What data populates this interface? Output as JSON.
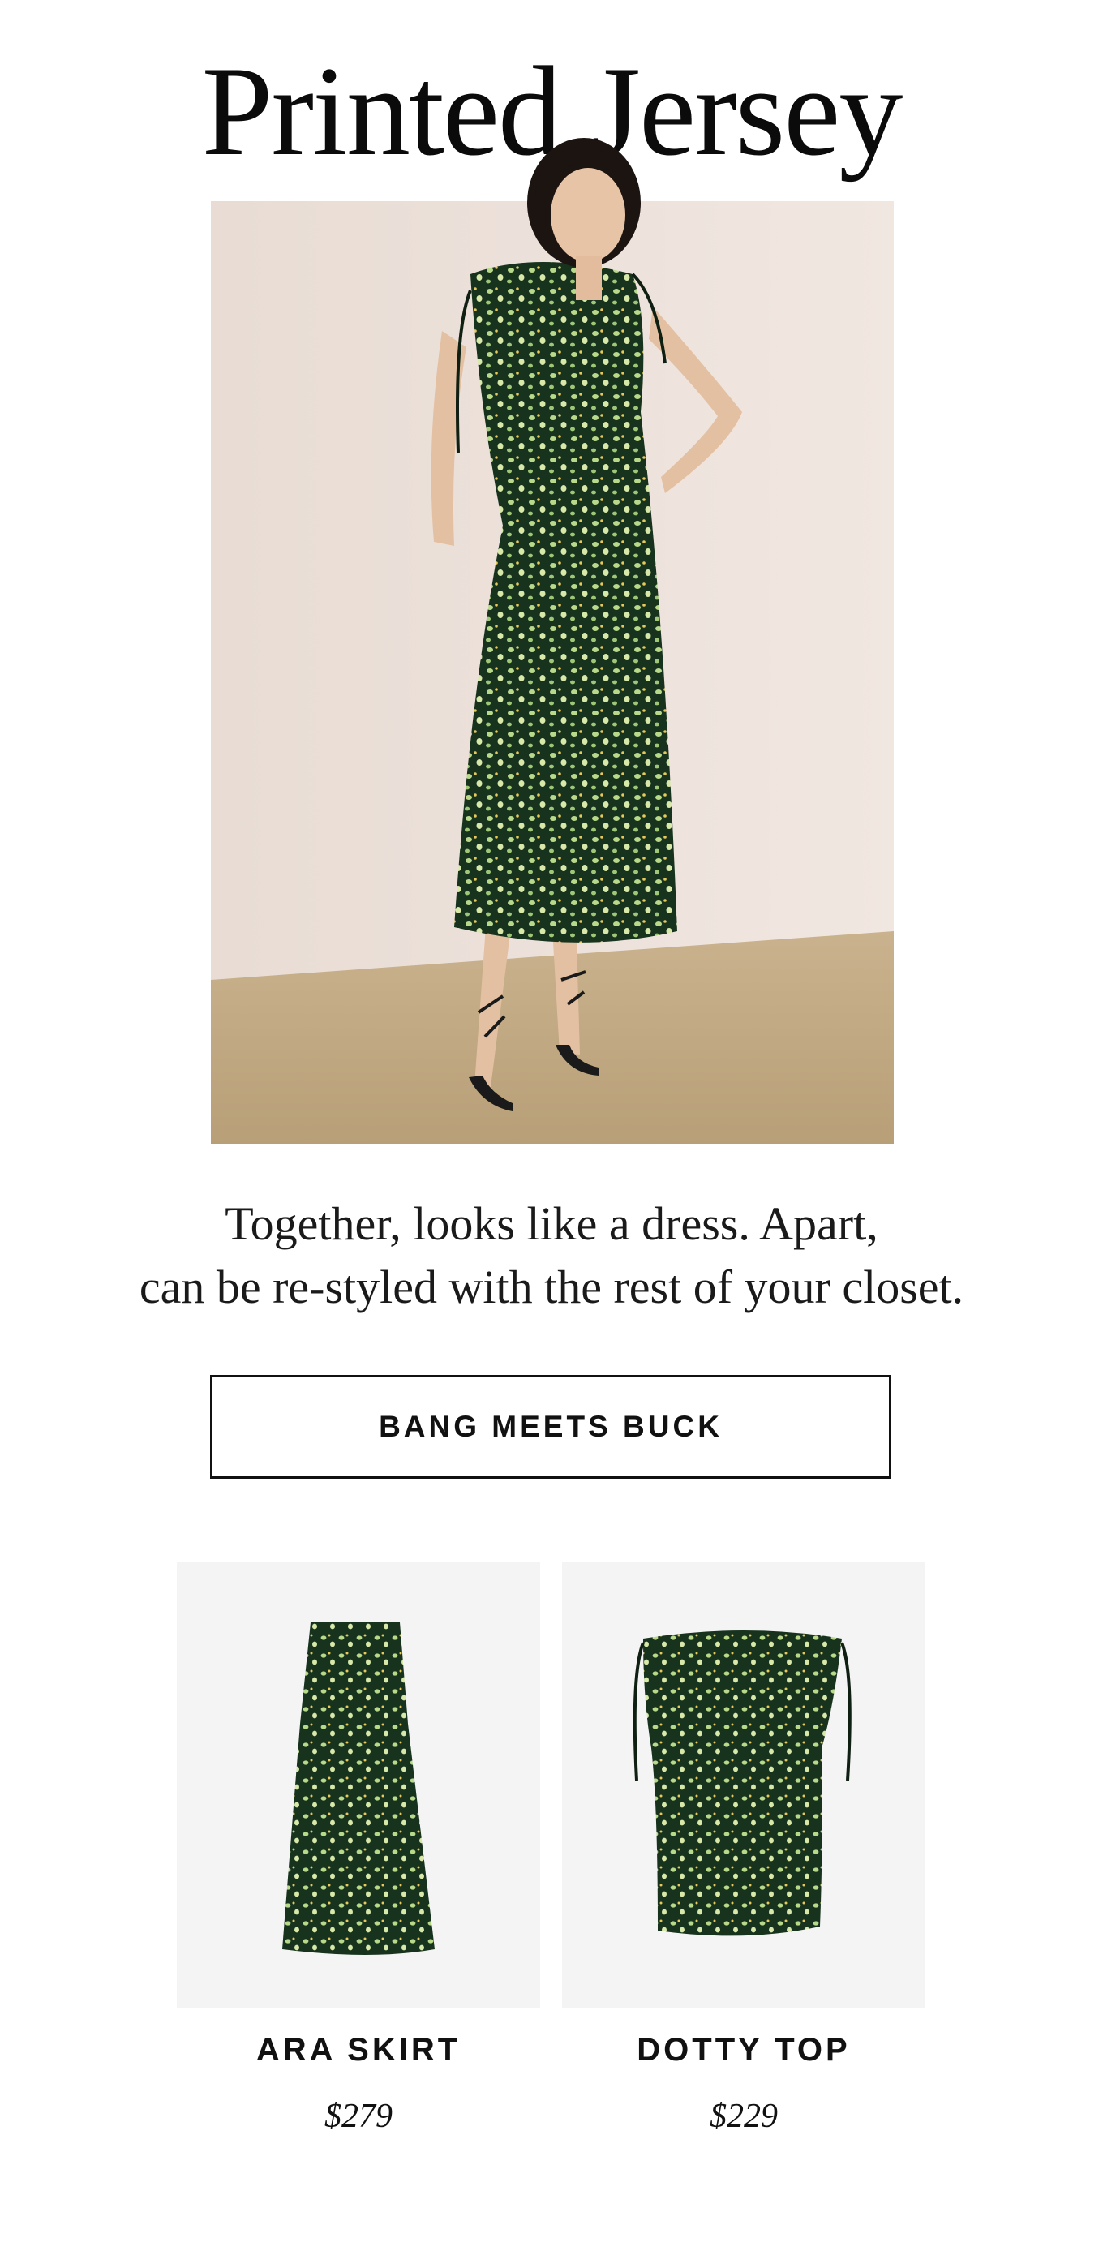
{
  "headline": "Printed Jersey",
  "hero": {
    "image_name": "model-in-green-printed-dress-image",
    "colors": {
      "wall": "#ece2dc",
      "floor": "#c2ab86",
      "dress": "#1c3a22",
      "print": "#b9d98a"
    }
  },
  "tagline": {
    "line1": "Together, looks like a dress. Apart,",
    "line2": "can be re-styled with the rest of your closet."
  },
  "cta": {
    "label": "BANG MEETS BUCK"
  },
  "products": [
    {
      "name": "ARA SKIRT",
      "price": "$279",
      "image_name": "ara-skirt-image"
    },
    {
      "name": "DOTTY TOP",
      "price": "$229",
      "image_name": "dotty-top-image"
    }
  ]
}
